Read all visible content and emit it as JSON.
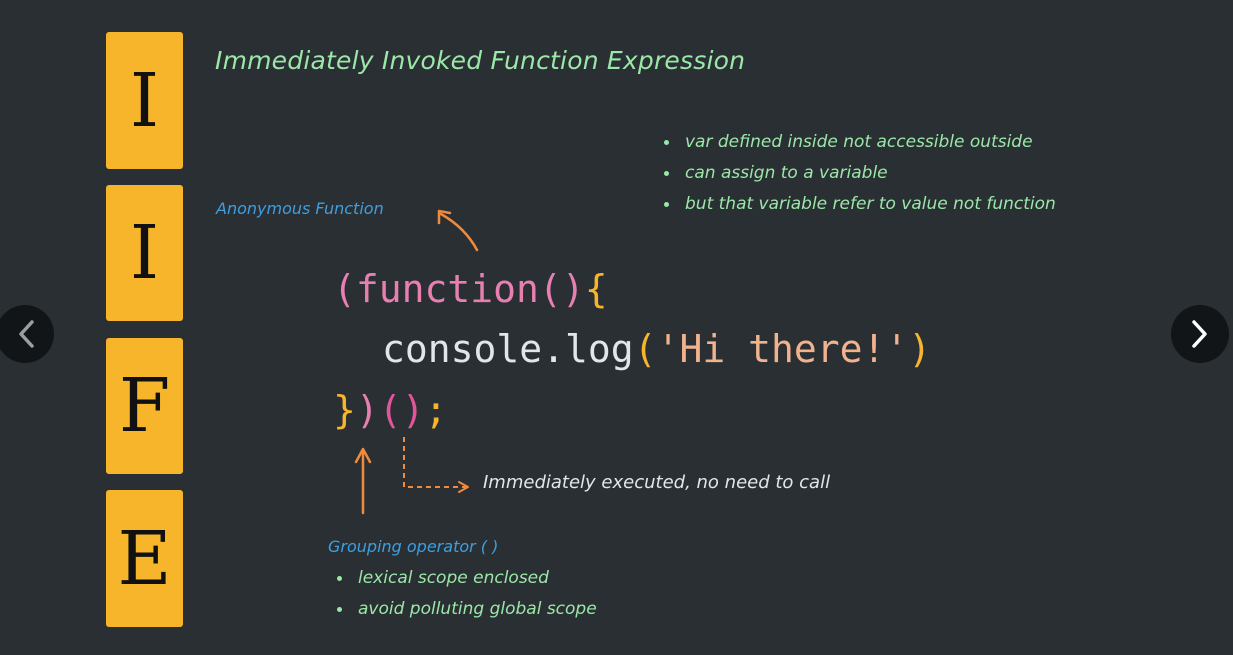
{
  "letters": [
    "I",
    "I",
    "F",
    "E"
  ],
  "title": "Immediately Invoked Function Expression",
  "notes": [
    "var defined inside not accessible outside",
    "can assign to a variable",
    "but that variable refer to value not function"
  ],
  "anon_label": "Anonymous Function",
  "code": {
    "line1_paren": "(",
    "line1_kw": "function",
    "line1_parens": "()",
    "line1_brace": "{",
    "line2_obj": "console",
    "line2_dot": ".",
    "line2_method": "log",
    "line2_open": "(",
    "line2_str": "'Hi there!'",
    "line2_close": ")",
    "line3_brace": "}",
    "line3_paren": ")",
    "line3_call": "()",
    "line3_semi": ";"
  },
  "exec_note": "Immediately executed, no need to call",
  "group_label": "Grouping operator ( )",
  "group_items": [
    "lexical scope enclosed",
    "avoid polluting global scope"
  ],
  "colors": {
    "background": "#2a2f33",
    "letter_box": "#f7b52c",
    "green_text": "#9be7a8",
    "blue_text": "#3d9fe0",
    "pink": "#e77fb0",
    "orange_arrow": "#f08a3c"
  },
  "nav": {
    "prev_icon": "chevron-left-icon",
    "next_icon": "chevron-right-icon"
  }
}
